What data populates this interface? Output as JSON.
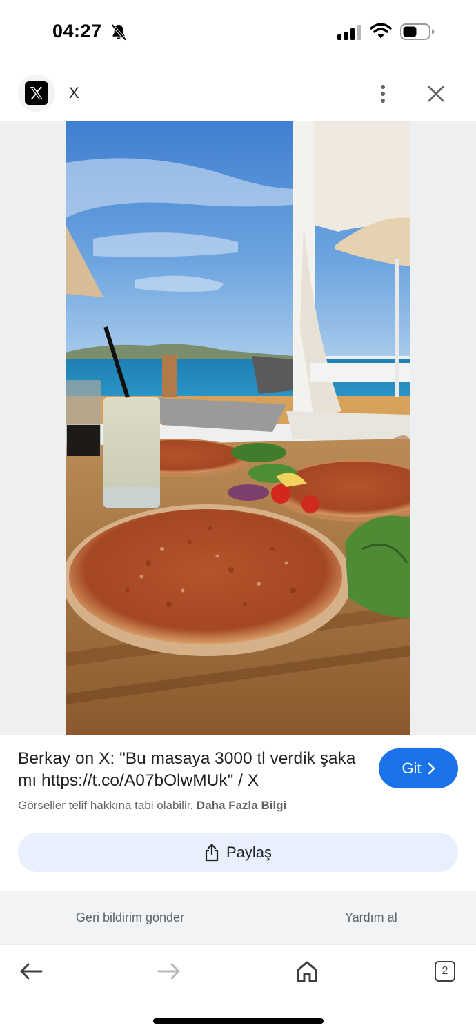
{
  "status_bar": {
    "time": "04:27",
    "icons": [
      "bell-slash-icon",
      "signal-icon",
      "wifi-icon",
      "battery-icon"
    ]
  },
  "header": {
    "site_name": "X",
    "logo_icon": "x-logo-icon",
    "more_icon": "more-vertical-icon",
    "close_icon": "close-icon"
  },
  "result": {
    "title": "Berkay on X: \"Bu masaya 3000 tl verdik şaka mı https://t.co/A07bOlwMUk\" / X",
    "go_label": "Git",
    "copyright_text": "Görseller telif hakkına tabi olabilir.",
    "learn_more": "Daha Fazla Bilgi",
    "share_label": "Paylaş"
  },
  "feedback": {
    "send_feedback": "Geri bildirim gönder",
    "get_help": "Yardım al"
  },
  "nav": {
    "tab_count": "2",
    "icons": [
      "back-arrow-icon",
      "forward-arrow-icon",
      "home-icon",
      "tabs-icon"
    ]
  },
  "colors": {
    "accent": "#1a73e8",
    "share_bg": "#e8f0fe",
    "image_bg": "#eeeff1"
  }
}
